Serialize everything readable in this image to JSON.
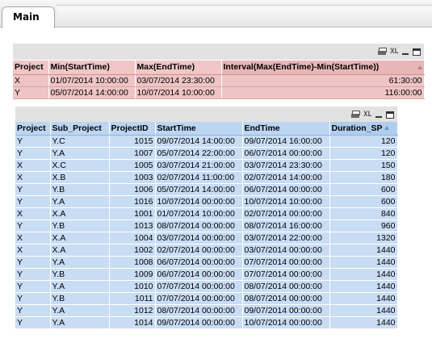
{
  "tabs": {
    "active": "Main"
  },
  "table1": {
    "caption_icons": [
      "print-icon",
      "xl-export-icon",
      "minimize-icon",
      "maximize-icon"
    ],
    "xl_label": "XL",
    "headers": [
      "Project",
      "Min(StartTime)",
      "Max(EndTime)",
      "Interval(Max(EndTime)-Min(StartTime))"
    ],
    "rows": [
      [
        "X",
        "01/07/2014 10:00:00",
        "03/07/2014 23:30:00",
        "61:30:00"
      ],
      [
        "Y",
        "05/07/2014 14:00:00",
        "10/07/2014 10:00:00",
        "116:00:00"
      ]
    ],
    "colors": {
      "header": "#f0c6c6",
      "row": "#eec4c4"
    }
  },
  "table2": {
    "caption_icons": [
      "print-icon",
      "xl-export-icon",
      "minimize-icon",
      "maximize-icon"
    ],
    "xl_label": "XL",
    "headers": [
      "Project",
      "Sub_Project",
      "ProjectID",
      "StartTime",
      "EndTime",
      "Duration_SP"
    ],
    "rows": [
      [
        "Y",
        "Y.C",
        "1015",
        "09/07/2014 14:00:00",
        "09/07/2014 16:00:00",
        "120"
      ],
      [
        "Y",
        "Y.A",
        "1007",
        "05/07/2014 22:00:00",
        "06/07/2014 00:00:00",
        "120"
      ],
      [
        "X",
        "X.C",
        "1005",
        "03/07/2014 21:00:00",
        "03/07/2014 23:30:00",
        "150"
      ],
      [
        "X",
        "X.B",
        "1003",
        "02/07/2014 11:00:00",
        "02/07/2014 14:00:00",
        "180"
      ],
      [
        "Y",
        "Y.B",
        "1006",
        "05/07/2014 14:00:00",
        "06/07/2014 00:00:00",
        "600"
      ],
      [
        "Y",
        "Y.A",
        "1016",
        "10/07/2014 00:00:00",
        "10/07/2014 10:00:00",
        "600"
      ],
      [
        "X",
        "X.A",
        "1001",
        "01/07/2014 10:00:00",
        "02/07/2014 00:00:00",
        "840"
      ],
      [
        "Y",
        "Y.B",
        "1013",
        "08/07/2014 00:00:00",
        "08/07/2014 16:00:00",
        "960"
      ],
      [
        "X",
        "X.A",
        "1004",
        "03/07/2014 00:00:00",
        "03/07/2014 22:00:00",
        "1320"
      ],
      [
        "X",
        "X.A",
        "1002",
        "02/07/2014 00:00:00",
        "03/07/2014 00:00:00",
        "1440"
      ],
      [
        "Y",
        "Y.A",
        "1008",
        "06/07/2014 00:00:00",
        "07/07/2014 00:00:00",
        "1440"
      ],
      [
        "Y",
        "Y.B",
        "1009",
        "06/07/2014 00:00:00",
        "07/07/2014 00:00:00",
        "1440"
      ],
      [
        "Y",
        "Y.A",
        "1010",
        "07/07/2014 00:00:00",
        "08/07/2014 00:00:00",
        "1440"
      ],
      [
        "Y",
        "Y.B",
        "1011",
        "07/07/2014 00:00:00",
        "08/07/2014 00:00:00",
        "1440"
      ],
      [
        "Y",
        "Y.A",
        "1012",
        "08/07/2014 00:00:00",
        "09/07/2014 00:00:00",
        "1440"
      ],
      [
        "Y",
        "Y.A",
        "1014",
        "09/07/2014 00:00:00",
        "10/07/2014 00:00:00",
        "1440"
      ]
    ],
    "colors": {
      "header": "#bcd6f2",
      "row": "#c8dcf4"
    }
  }
}
